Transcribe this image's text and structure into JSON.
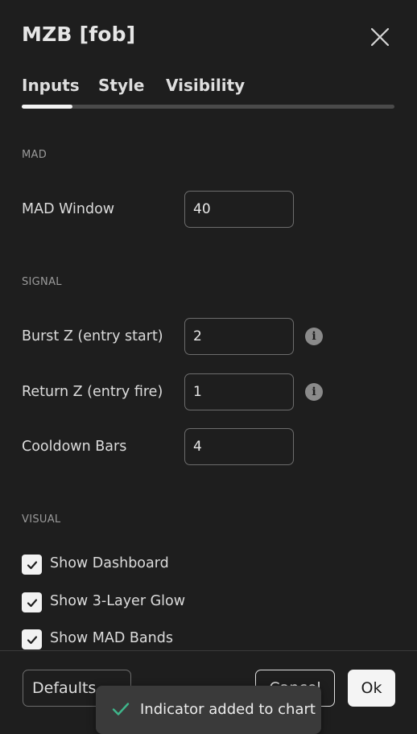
{
  "dialog": {
    "title": "MZB [fob]",
    "tabs": [
      {
        "label": "Inputs",
        "active": true
      },
      {
        "label": "Style",
        "active": false
      },
      {
        "label": "Visibility",
        "active": false
      }
    ]
  },
  "sections": {
    "mad": {
      "heading": "MAD",
      "window_label": "MAD Window",
      "window_value": "40"
    },
    "signal": {
      "heading": "SIGNAL",
      "burst_label": "Burst Z (entry start)",
      "burst_value": "2",
      "return_label": "Return Z (entry fire)",
      "return_value": "1",
      "cooldown_label": "Cooldown Bars",
      "cooldown_value": "4"
    },
    "visual": {
      "heading": "VISUAL",
      "checks": [
        {
          "label": "Show Dashboard",
          "checked": true
        },
        {
          "label": "Show 3-Layer Glow",
          "checked": true
        },
        {
          "label": "Show MAD Bands",
          "checked": true
        }
      ]
    }
  },
  "footer": {
    "defaults_label": "Defaults",
    "cancel_label": "Cancel",
    "ok_label": "Ok"
  },
  "toast": {
    "message": "Indicator added to chart",
    "icon": "checkmark-icon",
    "icon_color": "#3fb68b"
  },
  "colors": {
    "background": "#1e1e1e",
    "text": "#dcdcdc",
    "accent": "#f2f2f2"
  }
}
